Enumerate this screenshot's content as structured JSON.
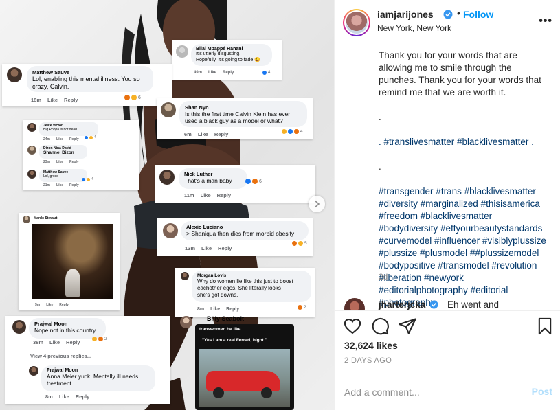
{
  "header": {
    "username": "iamjarijones",
    "follow_label": "Follow",
    "location": "New York, New York",
    "separator": "•",
    "more_label": "•••"
  },
  "image_comments": [
    {
      "name": "Bilal Mbappé Hanani",
      "lines": [
        "It's utterly disgusting.",
        "Hopefully, it's going to fade 😃"
      ],
      "meta": [
        "49m",
        "Like",
        "Reply"
      ],
      "count": "4"
    },
    {
      "name": "Matthew Sauve",
      "lines": [
        "Lol, enabling this mental illness. You so",
        "crazy, Calvin."
      ],
      "meta": [
        "18m",
        "Like",
        "Reply"
      ],
      "count": "6"
    },
    {
      "name": "Shan Nyn",
      "lines": [
        "Is this the first time Calvin Klein has ever",
        "used a black guy as a model or what?"
      ],
      "meta": [
        "6m",
        "Like",
        "Reply"
      ],
      "count": "4"
    },
    {
      "name": "Jeike Victor",
      "lines": [
        "Big Poppa is not dead"
      ],
      "meta": [
        "24m",
        "Like",
        "Reply"
      ],
      "count": "4"
    },
    {
      "name": "Dizon Nina David",
      "lines": [
        "Shannel Dizon"
      ],
      "meta": [
        "23m",
        "Like",
        "Reply"
      ],
      "count": ""
    },
    {
      "name": "Matthew Sauve",
      "lines": [
        "Lol, gross"
      ],
      "meta": [
        "21m",
        "Like",
        "Reply"
      ],
      "count": "4"
    },
    {
      "name": "Nick Luther",
      "lines": [
        "That's a man baby"
      ],
      "meta": [
        "11m",
        "Like",
        "Reply"
      ],
      "count": "6"
    },
    {
      "name": "Mardo Stewart",
      "lines": [],
      "meta": [
        "5m",
        "Like",
        "Reply"
      ],
      "count": ""
    },
    {
      "name": "Alexio Luciano",
      "lines": [
        "> Shaniqua then dies from morbid obesity"
      ],
      "meta": [
        "13m",
        "Like",
        "Reply"
      ],
      "count": "5"
    },
    {
      "name": "Morgan Lovis",
      "lines": [
        "Why do women lie like this just to boost",
        "eachother egos. She literally looks",
        "she's got downs."
      ],
      "meta": [
        "8m",
        "Like",
        "Reply"
      ],
      "count": "2"
    },
    {
      "name": "Prajwal Moon",
      "lines": [
        "Nope not in this country"
      ],
      "meta": [
        "38m",
        "Like",
        "Reply"
      ],
      "count": "2"
    },
    {
      "name": "Prajwal Moon",
      "lines": [
        "Anna Meier yuck. Mentally ill needs",
        "treatment"
      ],
      "meta": [
        "8m",
        "Like",
        "Reply"
      ],
      "count": ""
    }
  ],
  "view_previous": "View 4 previous replies...",
  "billy": {
    "name": "Billy Seabolt",
    "meme_top": "transwomen be like...",
    "meme_quote": "\"Yes I am a real Ferrari, bigot.\""
  },
  "caption": {
    "intro": "Thank you for your words that are allowing me to smile through the punches. Thank you for your words that remind me that we are worth it.",
    "dot1": ".",
    "line_hash1": ". #translivesmatter #blacklivesmatter .",
    "dot2": ".",
    "hashtags": "#transgender #trans #blacklivesmatter #diversity #marginalized #thisisamerica #freedom #blacklivesmatter #bodydiversity #effyourbeautystandards #curvemodel #influencer #visiblyplussize #plussize #plusmodel ##plussizemodel #bodypositive #transmodel #revolution #liberation #newyork #editorialphotography #editorial #photography",
    "timestamp": "2d"
  },
  "reply": {
    "username": "jharterjcka",
    "text": "Eh went and"
  },
  "actions": {
    "likes": "32,624 likes",
    "ago": "2 DAYS AGO"
  },
  "add_comment": {
    "placeholder": "Add a comment...",
    "post_label": "Post"
  },
  "colors": {
    "accent": "#0095f6",
    "post_disabled": "#b2dffc",
    "hashtag": "#00376b",
    "angry": "#e9710f",
    "haha": "#f7b125",
    "like": "#1877f2"
  },
  "icons": [
    "verified-badge-icon",
    "more-options-icon",
    "heart-icon",
    "comment-icon",
    "share-icon",
    "bookmark-icon",
    "chevron-right-icon"
  ]
}
